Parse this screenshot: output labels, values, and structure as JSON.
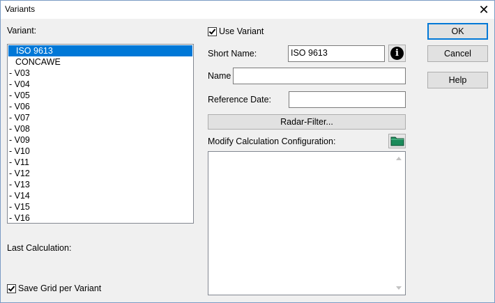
{
  "window": {
    "title": "Variants",
    "close_label": "✕"
  },
  "variant_list": {
    "label": "Variant:",
    "items": [
      {
        "label": "ISO 9613",
        "selected": true
      },
      {
        "label": "CONCAWE",
        "selected": false
      },
      {
        "label": "- V03"
      },
      {
        "label": "- V04"
      },
      {
        "label": "- V05"
      },
      {
        "label": "- V06"
      },
      {
        "label": "- V07"
      },
      {
        "label": "- V08"
      },
      {
        "label": "- V09"
      },
      {
        "label": "- V10"
      },
      {
        "label": "- V11"
      },
      {
        "label": "- V12"
      },
      {
        "label": "- V13"
      },
      {
        "label": "- V14"
      },
      {
        "label": "- V15"
      },
      {
        "label": "- V16"
      }
    ]
  },
  "last_calculation": {
    "label": "Last Calculation:"
  },
  "save_grid": {
    "label": "Save Grid per Variant",
    "checked": true
  },
  "use_variant": {
    "label": "Use Variant",
    "checked": true
  },
  "short_name": {
    "label": "Short Name:",
    "value": "ISO 9613"
  },
  "name": {
    "label": "Name",
    "value": ""
  },
  "reference_date": {
    "label": "Reference Date:",
    "value": ""
  },
  "radar_filter": {
    "label": "Radar-Filter..."
  },
  "modify_calc": {
    "label": "Modify Calculation Configuration:",
    "value": ""
  },
  "buttons": {
    "ok": "OK",
    "cancel": "Cancel",
    "help": "Help"
  },
  "icons": {
    "info": "info-icon",
    "folder": "folder-icon",
    "close": "close-icon"
  },
  "colors": {
    "selection": "#0078d7",
    "folder": "#1a8a5a"
  }
}
